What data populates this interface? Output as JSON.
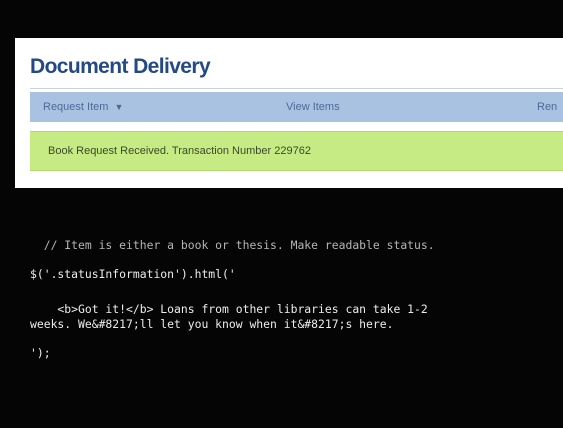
{
  "page": {
    "title": "Document Delivery"
  },
  "nav": {
    "request_item": "Request Item",
    "request_caret": "▼",
    "view_items": "View Items",
    "truncated": "Ren"
  },
  "status": {
    "message": "Book Request Received. Transaction Number 229762"
  },
  "code": {
    "comment": "  // Item is either a book or thesis. Make readable status.",
    "line1": "$('.statusInformation').html('",
    "line2": "    <b>Got it!</b> Loans from other libraries can take 1-2",
    "line3": "weeks. We&#8217;ll let you know when it&#8217;s here.",
    "line4": "');"
  },
  "colors": {
    "title": "#234a86",
    "nav_bg": "#a9c2e2",
    "status_bg": "#c6ea84",
    "terminal_bg": "#050505"
  }
}
